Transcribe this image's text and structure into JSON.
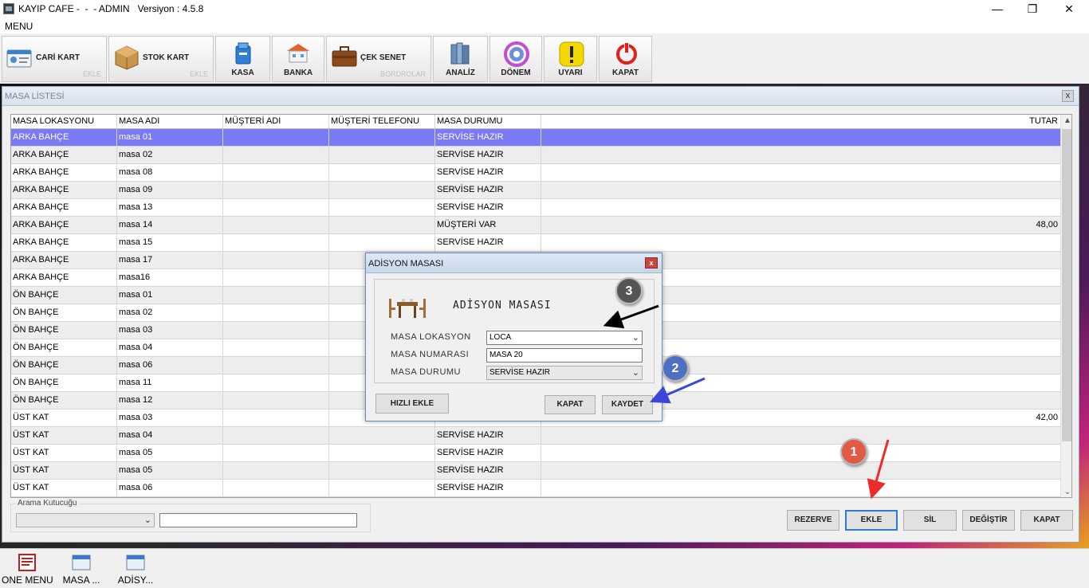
{
  "window": {
    "title": "KAYIP CAFE -  -  - ADMIN   Versiyon : 4.5.8",
    "minimize": "—",
    "restore": "❐",
    "close": "✕"
  },
  "menu": {
    "label": "MENU"
  },
  "toolbar": {
    "cari_kart": {
      "label": "CARİ KART",
      "sub": "EKLE"
    },
    "stok_kart": {
      "label": "STOK KART",
      "sub": "EKLE"
    },
    "kasa": {
      "label": "KASA"
    },
    "banka": {
      "label": "BANKA"
    },
    "cek_senet": {
      "label": "ÇEK SENET",
      "sub": "BORDROLAR"
    },
    "analiz": {
      "label": "ANALİZ"
    },
    "donem": {
      "label": "DÖNEM"
    },
    "uyari": {
      "label": "UYARI"
    },
    "kapat": {
      "label": "KAPAT"
    }
  },
  "table_window": {
    "title": "MASA LİSTESİ",
    "close": "x",
    "columns": [
      "MASA LOKASYONU",
      "MASA ADI",
      "MÜŞTERİ ADI",
      "MÜŞTERİ TELEFONU",
      "MASA DURUMU",
      "TUTAR"
    ],
    "rows": [
      [
        "ARKA BAHÇE",
        "masa 01",
        "",
        "",
        "SERVİSE HAZIR",
        ""
      ],
      [
        "ARKA BAHÇE",
        "masa 02",
        "",
        "",
        "SERVİSE HAZIR",
        ""
      ],
      [
        "ARKA BAHÇE",
        "masa 08",
        "",
        "",
        "SERVİSE HAZIR",
        ""
      ],
      [
        "ARKA BAHÇE",
        "masa 09",
        "",
        "",
        "SERVİSE HAZIR",
        ""
      ],
      [
        "ARKA BAHÇE",
        "masa 13",
        "",
        "",
        "SERVİSE HAZIR",
        ""
      ],
      [
        "ARKA BAHÇE",
        "masa 14",
        "",
        "",
        "MÜŞTERİ VAR",
        "48,00"
      ],
      [
        "ARKA BAHÇE",
        "masa 15",
        "",
        "",
        "SERVİSE HAZIR",
        ""
      ],
      [
        "ARKA BAHÇE",
        "masa 17",
        "",
        "",
        "",
        ""
      ],
      [
        "ARKA BAHÇE",
        "masa16",
        "",
        "",
        "",
        ""
      ],
      [
        "ÖN BAHÇE",
        "masa 01",
        "",
        "",
        "",
        ""
      ],
      [
        "ÖN BAHÇE",
        "masa 02",
        "",
        "",
        "",
        ""
      ],
      [
        "ÖN BAHÇE",
        "masa 03",
        "",
        "",
        "",
        ""
      ],
      [
        "ÖN BAHÇE",
        "masa 04",
        "",
        "",
        "",
        ""
      ],
      [
        "ÖN BAHÇE",
        "masa 06",
        "",
        "",
        "",
        ""
      ],
      [
        "ÖN BAHÇE",
        "masa 11",
        "",
        "",
        "",
        ""
      ],
      [
        "ÖN BAHÇE",
        "masa 12",
        "",
        "",
        "",
        ""
      ],
      [
        "ÜST KAT",
        "masa 03",
        "",
        "",
        "",
        "42,00"
      ],
      [
        "ÜST KAT",
        "masa 04",
        "",
        "",
        "SERVİSE HAZIR",
        ""
      ],
      [
        "ÜST KAT",
        "masa 05",
        "",
        "",
        "SERVİSE HAZIR",
        ""
      ],
      [
        "ÜST KAT",
        "masa 05",
        "",
        "",
        "SERVİSE HAZIR",
        ""
      ],
      [
        "ÜST KAT",
        "masa 06",
        "",
        "",
        "SERVİSE HAZIR",
        ""
      ]
    ],
    "selected_row": 0,
    "search_label": "Arama Kutucuğu",
    "buttons": {
      "rezerve": "REZERVE",
      "ekle": "EKLE",
      "sil": "SİL",
      "degistir": "DEĞİŞTİR",
      "kapat": "KAPAT"
    }
  },
  "dialog": {
    "title": "ADİSYON MASASI",
    "close": "x",
    "heading": "ADİSYON MASASI",
    "lokasyon_label": "MASA LOKASYON",
    "lokasyon_value": "LOCA",
    "numara_label": "MASA NUMARASI",
    "numara_value": "MASA 20",
    "durum_label": "MASA DURUMU",
    "durum_value": "SERVİSE HAZIR",
    "hizli_ekle": "HIZLI EKLE",
    "kapat": "KAPAT",
    "kaydet": "KAYDET"
  },
  "annotations": {
    "one": "1",
    "two": "2",
    "three": "3"
  },
  "taskbar": {
    "items": [
      "ONE MENU",
      "MASA ...",
      "ADİSY..."
    ]
  },
  "colors": {
    "selection": "#7a7af5",
    "callout_red": "#e05a45",
    "callout_blue": "#4d6fc4",
    "callout_dark": "#555555"
  }
}
